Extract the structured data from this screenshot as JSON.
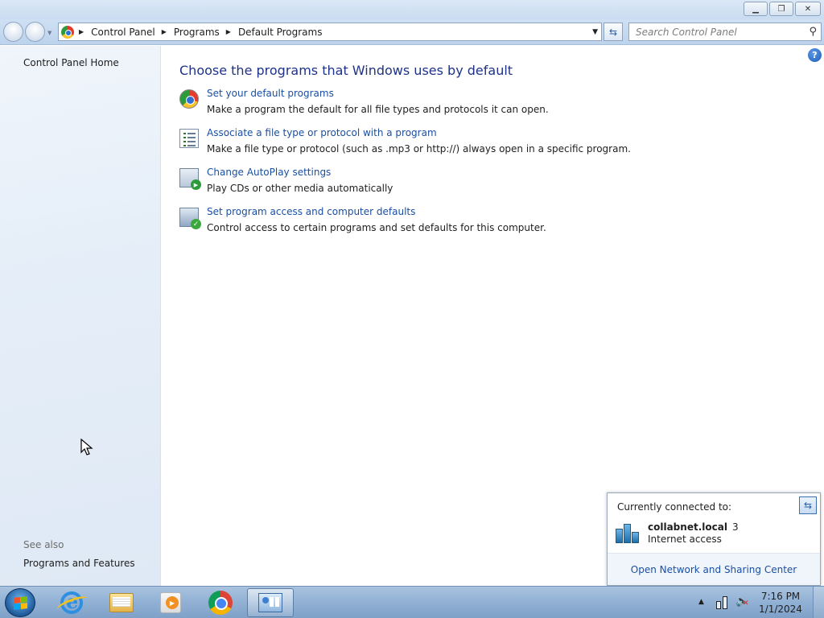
{
  "window": {
    "minimize_icon": "minimize-icon",
    "restore_icon": "restore-icon",
    "close_icon": "close-icon"
  },
  "address_bar": {
    "crumbs": [
      "Control Panel",
      "Programs",
      "Default Programs"
    ],
    "search_placeholder": "Search Control Panel"
  },
  "sidebar": {
    "home_link": "Control Panel Home",
    "see_also_label": "See also",
    "see_also_links": [
      "Programs and Features"
    ]
  },
  "main": {
    "heading": "Choose the programs that Windows uses by default",
    "help_icon": "?",
    "items": [
      {
        "link": "Set your default programs",
        "description": "Make a program the default for all file types and protocols it can open.",
        "icon": "default-programs-icon"
      },
      {
        "link": "Associate a file type or protocol with a program",
        "description": "Make a file type or protocol (such as .mp3 or http://) always open in a specific program.",
        "icon": "file-association-icon"
      },
      {
        "link": "Change AutoPlay settings",
        "description": "Play CDs or other media automatically",
        "icon": "autoplay-icon"
      },
      {
        "link": "Set program access and computer defaults",
        "description": "Control access to certain programs and set defaults for this computer.",
        "icon": "program-access-icon"
      }
    ]
  },
  "network_popup": {
    "title": "Currently connected to:",
    "network_name": "collabnet.local",
    "network_number": "3",
    "network_status": "Internet access",
    "footer_link": "Open Network and Sharing Center"
  },
  "taskbar": {
    "apps": [
      "internet-explorer",
      "windows-explorer",
      "media-player",
      "chrome",
      "control-panel"
    ],
    "active_app": "control-panel",
    "clock_time": "7:16 PM",
    "clock_date": "1/1/2024"
  },
  "colors": {
    "link": "#1a4fa3",
    "heading": "#1e3287",
    "taskbar": "#93b2d5"
  }
}
